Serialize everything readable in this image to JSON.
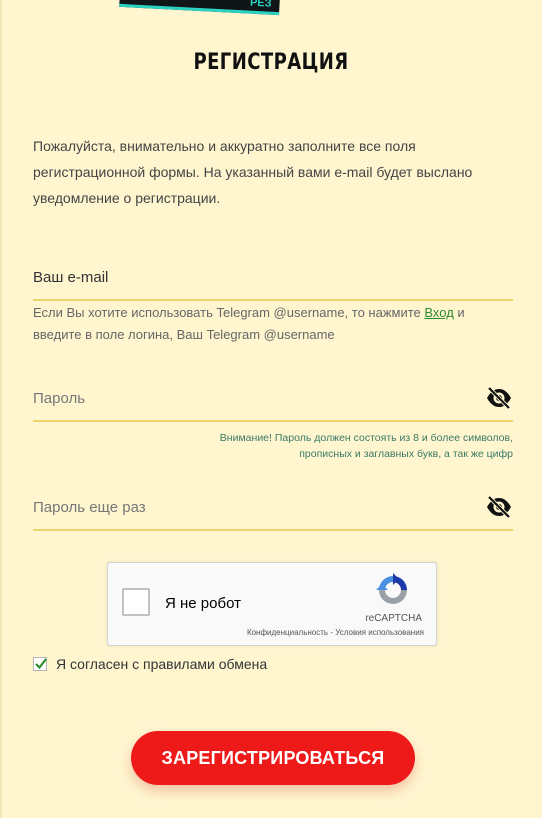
{
  "banner": {
    "fragment_text": "РЕЗ"
  },
  "header": {
    "title": "РЕГИСТРАЦИЯ"
  },
  "intro": {
    "text": "Пожалуйста, внимательно и аккуратно заполните все поля регистрационной формы. На указанный вами e-mail будет выслано уведомление о регистрации."
  },
  "email": {
    "placeholder": "Ваш e-mail",
    "hint_before": "Если Вы хотите использовать Telegram @username, то нажмите ",
    "hint_link": "Вход",
    "hint_after": " и введите в поле логина, Ваш Telegram @username"
  },
  "password": {
    "placeholder": "Пароль",
    "warning_line1": "Внимание! Пароль должен состоять из 8 и более символов,",
    "warning_line2": "прописных и заглавных букв, а так же цифр",
    "eye_icon": "eye-slash-icon"
  },
  "password_repeat": {
    "placeholder": "Пароль еще раз",
    "eye_icon": "eye-slash-icon"
  },
  "captcha": {
    "label": "Я не робот",
    "brand": "reCAPTCHA",
    "privacy": "Конфиденциальность",
    "separator": " - ",
    "terms": "Условия использования"
  },
  "agreement": {
    "label": "Я согласен с правилами обмена",
    "checked": true
  },
  "submit": {
    "label": "ЗАРЕГИСТРИРОВАТЬСЯ"
  },
  "colors": {
    "background": "#fff6d0",
    "field_underline": "#ecd36a",
    "submit": "#ee1a1a",
    "link": "#2e8a2e",
    "warning_text": "#3a7a66"
  }
}
